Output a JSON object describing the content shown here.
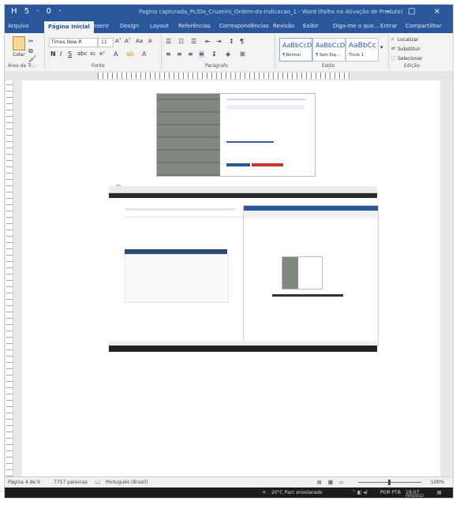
{
  "title_bar": {
    "quick_access": "H 5 · 0 ·",
    "title": "Pagina capturada_Pc/Do_Cruzeiro_Ordem-da-Indicacao_1 - Word (Falha na Ativação de Produto)",
    "window_controls": "– □ ×"
  },
  "tabs": [
    "Arquivo",
    "Página Inicial",
    "Inserir",
    "Design",
    "Layout",
    "Referências",
    "Correspondências",
    "Revisão",
    "Exibir",
    "Diga-me o que...",
    "Entrar",
    "Compartilhar"
  ],
  "ribbon": {
    "clipboard": {
      "paste": "Colar",
      "label": "Área de Tr..."
    },
    "font": {
      "name": "Times New R",
      "size": "11",
      "label": "Fonte"
    },
    "paragraph": {
      "label": "Parágrafo"
    },
    "styles": {
      "items": [
        {
          "preview": "AaBbCcDc",
          "name": "¶ Normal"
        },
        {
          "preview": "AaBbCcDc",
          "name": "¶ Sem Esp..."
        },
        {
          "preview": "AaBbCc",
          "name": "Título 1"
        }
      ],
      "label": "Estilo"
    },
    "editing": {
      "find": "Localizar",
      "replace": "Substituir",
      "select": "Selecionar",
      "label": "Edição"
    }
  },
  "status_bar": {
    "page": "Página 4 de 9",
    "words": "7757 palavras",
    "language": "Português (Brasil)",
    "zoom": "100%"
  },
  "taskbar": {
    "weather": "20°C Parc ensolarado",
    "lang": "POR PTB",
    "time": "19:07",
    "date": "09/03/2022"
  },
  "colors": {
    "word_blue": "#2b579a",
    "taskbar": "#1c1c1c"
  }
}
